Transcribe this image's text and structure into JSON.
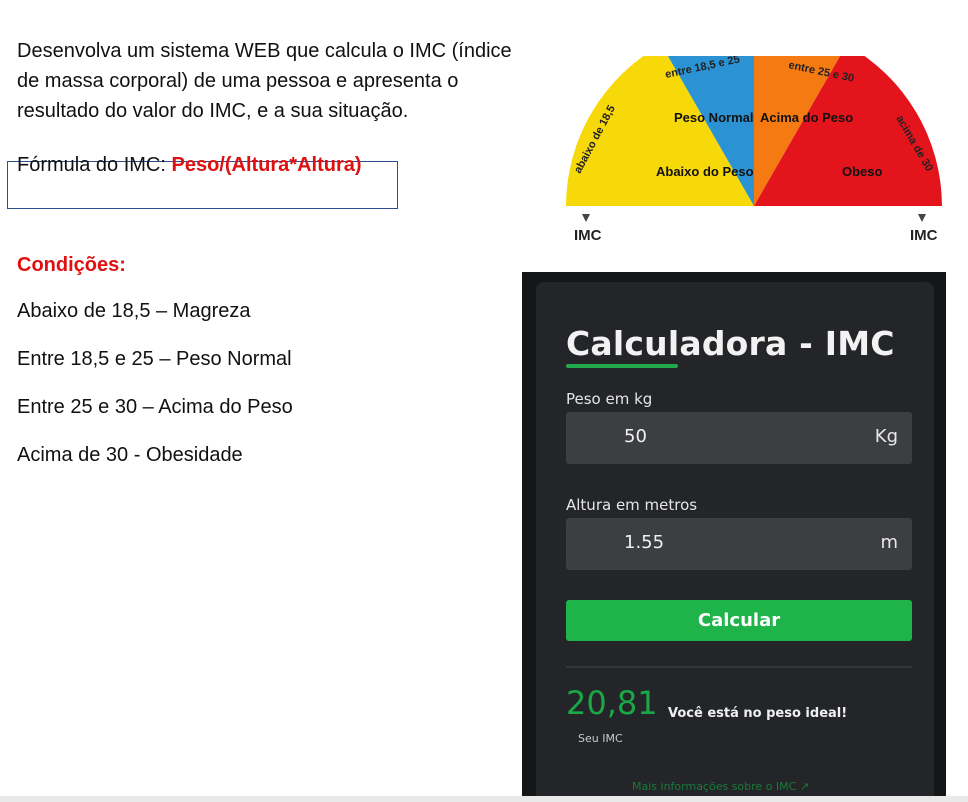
{
  "document": {
    "intro_lines": [
      "Desenvolva um sistema WEB que calcula o IMC (índice",
      "de massa corporal) de uma pessoa e apresenta o",
      "resultado do valor do IMC, e a sua situação."
    ],
    "formula_label": "Fórmula do IMC: ",
    "formula_value": "Peso/(Altura*Altura)",
    "conditions_title": "Condições:",
    "conditions": [
      "Abaixo de 18,5 – Magreza",
      "Entre 18,5 e 25 – Peso Normal",
      "Entre 25 e 30 – Acima do Peso",
      "Acima de 30 - Obesidade"
    ]
  },
  "gauge": {
    "segments": [
      {
        "label": "Abaixo do Peso",
        "outer_label": "abaixo de 18,5",
        "color": "#f7d909"
      },
      {
        "label": "Peso Normal",
        "outer_label": "entre 18,5 e 25",
        "color": "#2b93d4"
      },
      {
        "label": "Acima do Peso",
        "outer_label": "entre 25 e 30",
        "color": "#f57a11"
      },
      {
        "label": "Obeso",
        "outer_label": "acima de 30",
        "color": "#e3141b"
      }
    ],
    "left_axis_label": "IMC",
    "right_axis_label": "IMC"
  },
  "calculator": {
    "title": "Calculadora - IMC",
    "peso_label": "Peso em kg",
    "peso_value": "50",
    "peso_unit": "Kg",
    "altura_label": "Altura em metros",
    "altura_value": "1.55",
    "altura_unit": "m",
    "button_label": "Calcular",
    "result_value": "20,81",
    "result_caption": "Seu IMC",
    "result_message": "Você está no peso ideal!",
    "more_info": "Mais informações sobre o IMC ↗",
    "accent_color": "#1fb44a"
  }
}
